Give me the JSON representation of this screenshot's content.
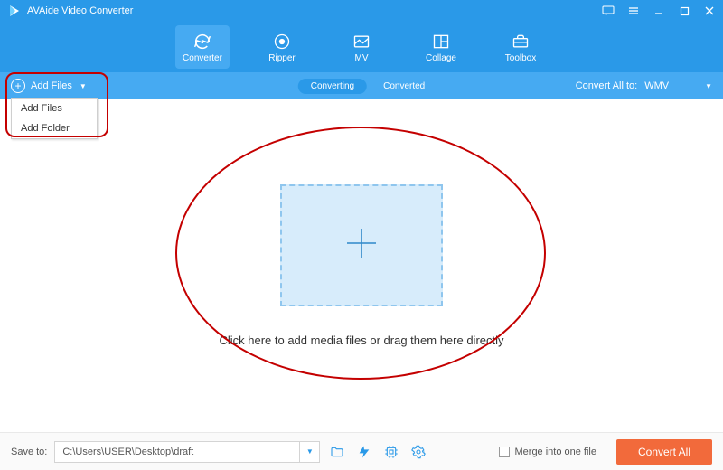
{
  "title": "AVAide Video Converter",
  "nav": {
    "converter": "Converter",
    "ripper": "Ripper",
    "mv": "MV",
    "collage": "Collage",
    "toolbox": "Toolbox"
  },
  "subbar": {
    "add_files": "Add Files",
    "converting": "Converting",
    "converted": "Converted",
    "convert_all_to": "Convert All to:",
    "format": "WMV"
  },
  "dropdown": {
    "add_files": "Add Files",
    "add_folder": "Add Folder"
  },
  "main": {
    "hint": "Click here to add media files or drag them here directly"
  },
  "bottom": {
    "save_to_label": "Save to:",
    "save_path": "C:\\Users\\USER\\Desktop\\draft",
    "merge_label": "Merge into one file",
    "convert_all": "Convert All"
  }
}
